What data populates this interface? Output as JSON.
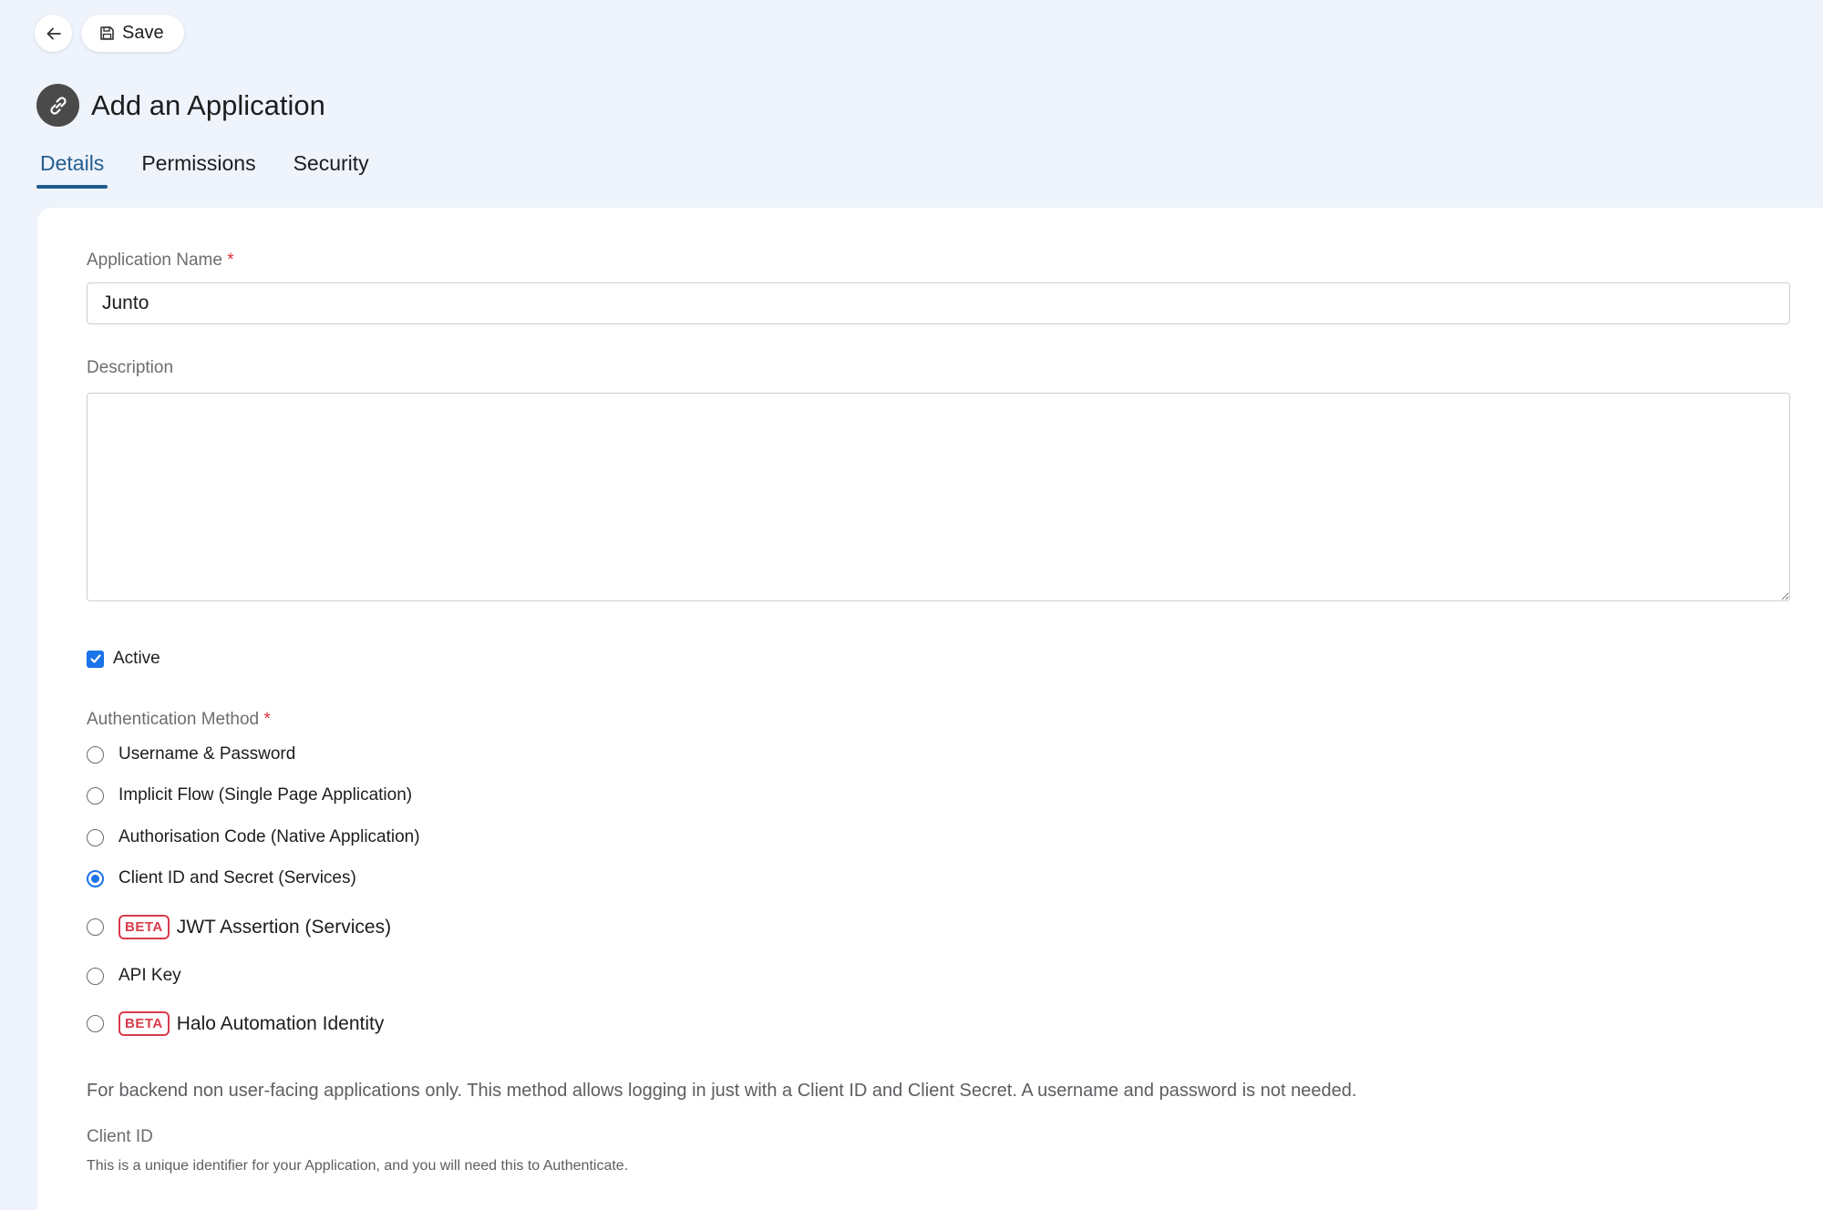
{
  "toolbar": {
    "save_label": "Save"
  },
  "header": {
    "title": "Add an Application"
  },
  "tabs": [
    {
      "label": "Details",
      "active": true
    },
    {
      "label": "Permissions",
      "active": false
    },
    {
      "label": "Security",
      "active": false
    }
  ],
  "form": {
    "app_name": {
      "label": "Application Name",
      "required_mark": "*",
      "value": "Junto"
    },
    "description": {
      "label": "Description",
      "value": ""
    },
    "active": {
      "label": "Active",
      "checked": true
    },
    "auth_method": {
      "label": "Authentication Method",
      "required_mark": "*",
      "options": [
        {
          "label": "Username & Password",
          "selected": false,
          "beta": false
        },
        {
          "label": "Implicit Flow (Single Page Application)",
          "selected": false,
          "beta": false
        },
        {
          "label": "Authorisation Code (Native Application)",
          "selected": false,
          "beta": false
        },
        {
          "label": "Client ID and Secret (Services)",
          "selected": true,
          "beta": false
        },
        {
          "label": "JWT Assertion (Services)",
          "selected": false,
          "beta": true
        },
        {
          "label": "API Key",
          "selected": false,
          "beta": false
        },
        {
          "label": "Halo Automation Identity",
          "selected": false,
          "beta": true
        }
      ],
      "beta_badge": "BETA",
      "help_text": "For backend non user-facing applications only. This method allows logging in just with a Client ID and Client Secret. A username and password is not needed."
    },
    "client_id": {
      "label": "Client ID",
      "subtext": "This is a unique identifier for your Application, and you will need this to Authenticate."
    }
  },
  "colors": {
    "background": "#eef3fc",
    "accent": "#1a73e8",
    "tab_active": "#1e5a8a",
    "beta": "#d83b4b",
    "required": "#dd3333"
  },
  "icons": {
    "back": "arrow-left-icon",
    "save": "floppy-disk-icon",
    "app": "link-icon",
    "check": "checkmark-icon"
  }
}
